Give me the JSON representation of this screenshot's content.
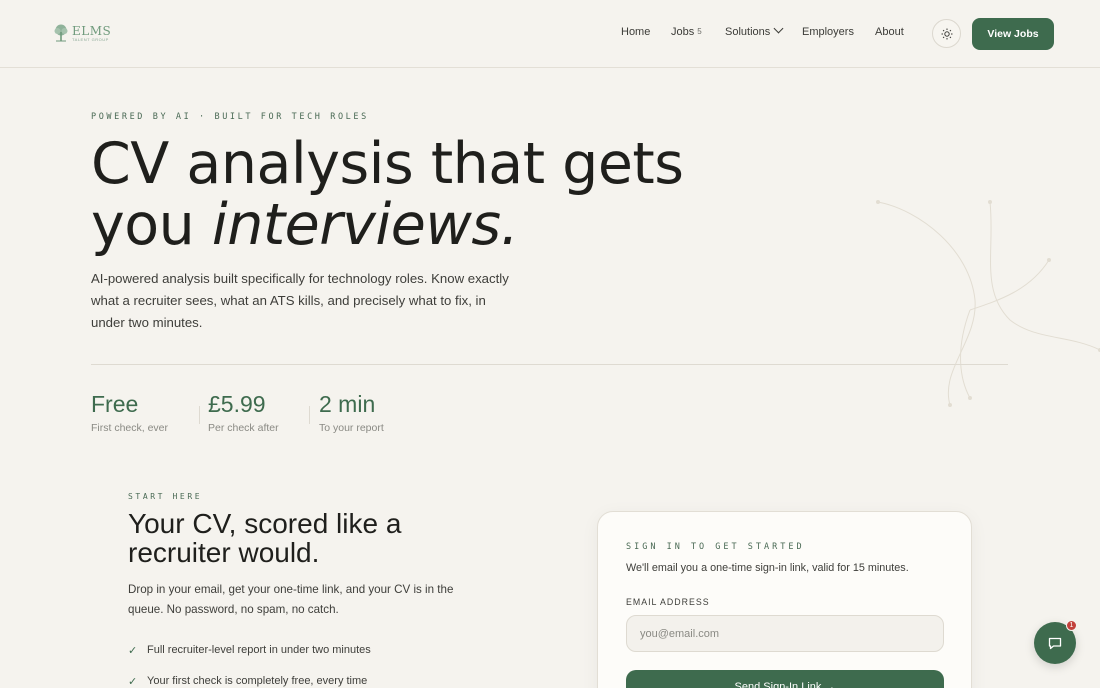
{
  "header": {
    "logo": {
      "name": "ELMS",
      "subtitle": "TALENT GROUP",
      "icon": "tree-icon"
    },
    "nav": [
      {
        "label": "Home"
      },
      {
        "label": "Jobs",
        "count": "5"
      },
      {
        "label": "Solutions",
        "icon": "chevron-down-icon"
      },
      {
        "label": "Employers"
      },
      {
        "label": "About"
      }
    ],
    "theme_toggle_icon": "sun-icon",
    "cta_label": "View Jobs"
  },
  "hero": {
    "eyebrow": "POWERED BY AI · BUILT FOR TECH ROLES",
    "title_line1": "CV analysis that gets",
    "title_line2_plain": "you ",
    "title_line2_italic": "interviews.",
    "subtitle": "AI-powered analysis built specifically for technology roles. Know exactly what a recruiter sees, what an ATS kills, and precisely what to fix, in under two minutes.",
    "stats": [
      {
        "value": "Free",
        "label": "First check, ever"
      },
      {
        "value": "£5.99",
        "label": "Per check after"
      },
      {
        "value": "2 min",
        "label": "To your report"
      }
    ]
  },
  "start": {
    "eyebrow": "START HERE",
    "title": "Your CV, scored like a recruiter would.",
    "body": "Drop in your email, get your one-time link, and your CV is in the queue. No password, no spam, no catch.",
    "checks": [
      "Full recruiter-level report in under two minutes",
      "Your first check is completely free, every time"
    ]
  },
  "signin": {
    "eyebrow": "SIGN IN TO GET STARTED",
    "description": "We'll email you a one-time sign-in link, valid for 15 minutes.",
    "email_label": "EMAIL ADDRESS",
    "email_placeholder": "you@email.com",
    "email_value": "",
    "submit_label": "Send Sign-In Link →"
  },
  "chat": {
    "icon": "chat-bubble-icon",
    "badge": "1"
  },
  "colors": {
    "accent": "#3e6b4e",
    "background": "#f5f3ee",
    "badge": "#c2413b"
  }
}
